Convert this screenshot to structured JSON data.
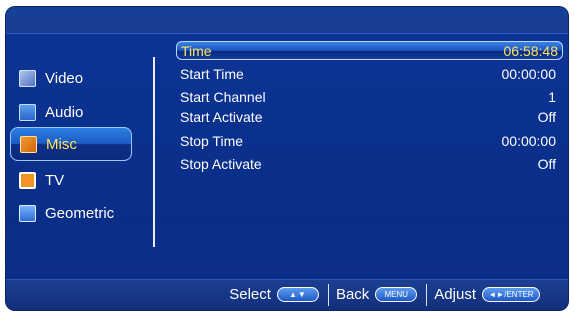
{
  "sidebar": {
    "items": [
      {
        "label": "Video",
        "icon": "video-icon"
      },
      {
        "label": "Audio",
        "icon": "audio-icon"
      },
      {
        "label": "Misc",
        "icon": "misc-icon"
      },
      {
        "label": "TV",
        "icon": "tv-icon"
      },
      {
        "label": "Geometric",
        "icon": "geometric-icon"
      }
    ]
  },
  "menu": {
    "rows": [
      {
        "label": "Time",
        "value": "06:58:48"
      },
      {
        "label": "Start Time",
        "value": "00:00:00"
      },
      {
        "label": "Start Channel",
        "value": "1"
      },
      {
        "label": "Start  Activate",
        "value": "Off"
      },
      {
        "label": "Stop Time",
        "value": "00:00:00"
      },
      {
        "label": "Stop  Activate",
        "value": "Off"
      }
    ]
  },
  "footer": {
    "select_label": "Select",
    "select_key": "▲▼",
    "back_label": "Back",
    "back_key": "MENU",
    "adjust_label": "Adjust",
    "adjust_key": "◄►/ENTER"
  },
  "colors": {
    "accent": "#ffe45a",
    "background": "#0a2f8a",
    "highlight": "#1d56c4"
  }
}
